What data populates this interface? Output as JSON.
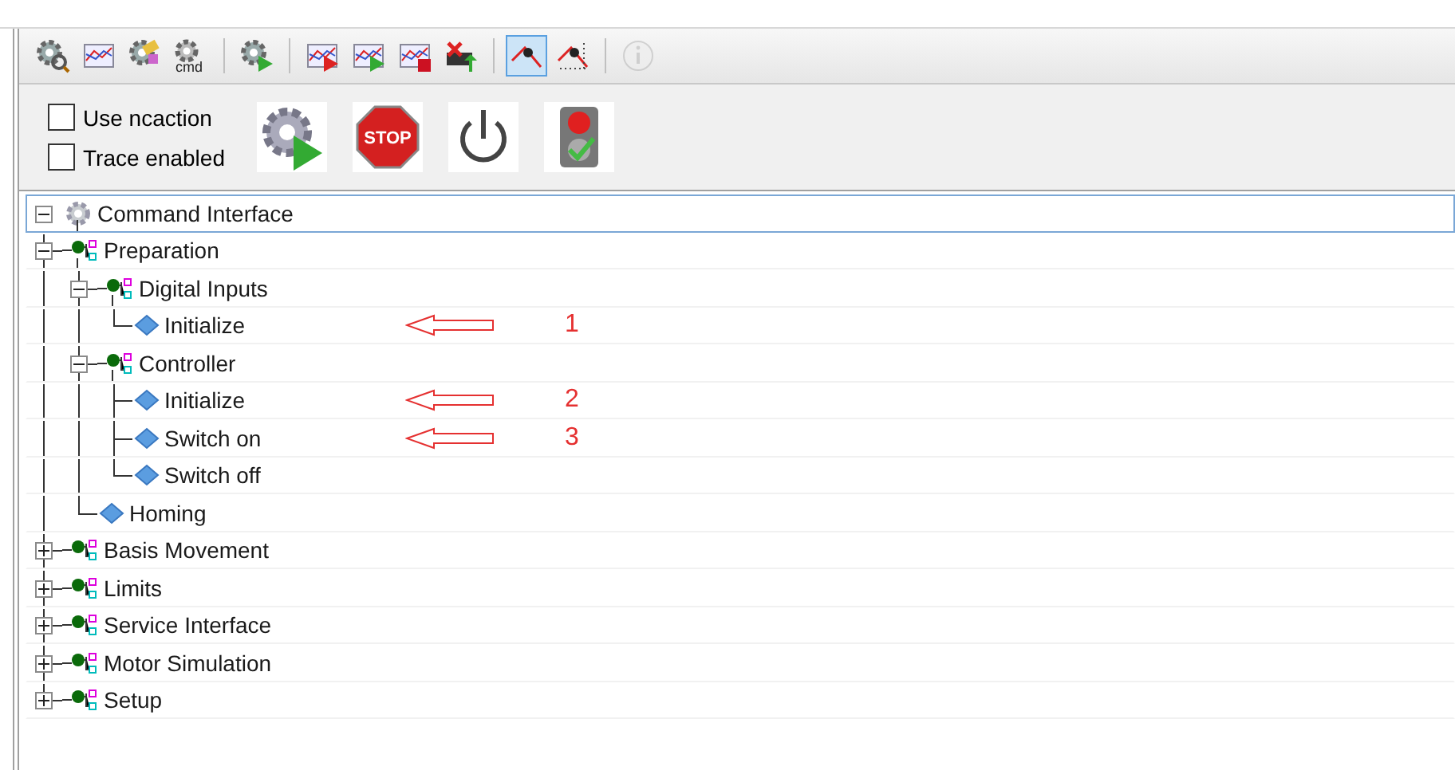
{
  "toolbar": [
    {
      "kind": "gear-search",
      "selected": false
    },
    {
      "kind": "chart",
      "selected": false
    },
    {
      "kind": "gears",
      "selected": false
    },
    {
      "kind": "cmd",
      "label": "cmd",
      "selected": false
    },
    {
      "kind": "separator"
    },
    {
      "kind": "gear-play",
      "selected": false
    },
    {
      "kind": "separator"
    },
    {
      "kind": "chart-play-red",
      "selected": false
    },
    {
      "kind": "chart-play-green",
      "selected": false
    },
    {
      "kind": "chart-stop",
      "selected": false
    },
    {
      "kind": "delete-upload",
      "selected": false
    },
    {
      "kind": "separator"
    },
    {
      "kind": "curve",
      "selected": true
    },
    {
      "kind": "curve-dotted",
      "selected": false
    },
    {
      "kind": "separator"
    },
    {
      "kind": "info",
      "selected": false,
      "disabled": true
    }
  ],
  "options": [
    {
      "label": "Use ncaction",
      "checked": false
    },
    {
      "label": "Trace enabled",
      "checked": false
    }
  ],
  "actions": [
    {
      "kind": "gear-play"
    },
    {
      "kind": "stop",
      "label": "STOP"
    },
    {
      "kind": "power"
    },
    {
      "kind": "traffic-light"
    }
  ],
  "tree": [
    {
      "label": "Command Interface",
      "kind": "root",
      "selected": true,
      "expanded": true,
      "children": [
        {
          "label": "Preparation",
          "kind": "group",
          "expanded": true,
          "children": [
            {
              "label": "Digital Inputs",
              "kind": "group",
              "expanded": true,
              "children": [
                {
                  "label": "Initialize",
                  "kind": "command",
                  "annotation": "1"
                }
              ]
            },
            {
              "label": "Controller",
              "kind": "group",
              "expanded": true,
              "children": [
                {
                  "label": "Initialize",
                  "kind": "command",
                  "annotation": "2"
                },
                {
                  "label": "Switch on",
                  "kind": "command",
                  "annotation": "3"
                },
                {
                  "label": "Switch off",
                  "kind": "command"
                }
              ]
            },
            {
              "label": "Homing",
              "kind": "command"
            }
          ]
        },
        {
          "label": "Basis Movement",
          "kind": "group",
          "expanded": false
        },
        {
          "label": "Limits",
          "kind": "group",
          "expanded": false
        },
        {
          "label": "Service Interface",
          "kind": "group",
          "expanded": false
        },
        {
          "label": "Motor Simulation",
          "kind": "group",
          "expanded": false
        },
        {
          "label": "Setup",
          "kind": "group",
          "expanded": false
        }
      ]
    }
  ]
}
